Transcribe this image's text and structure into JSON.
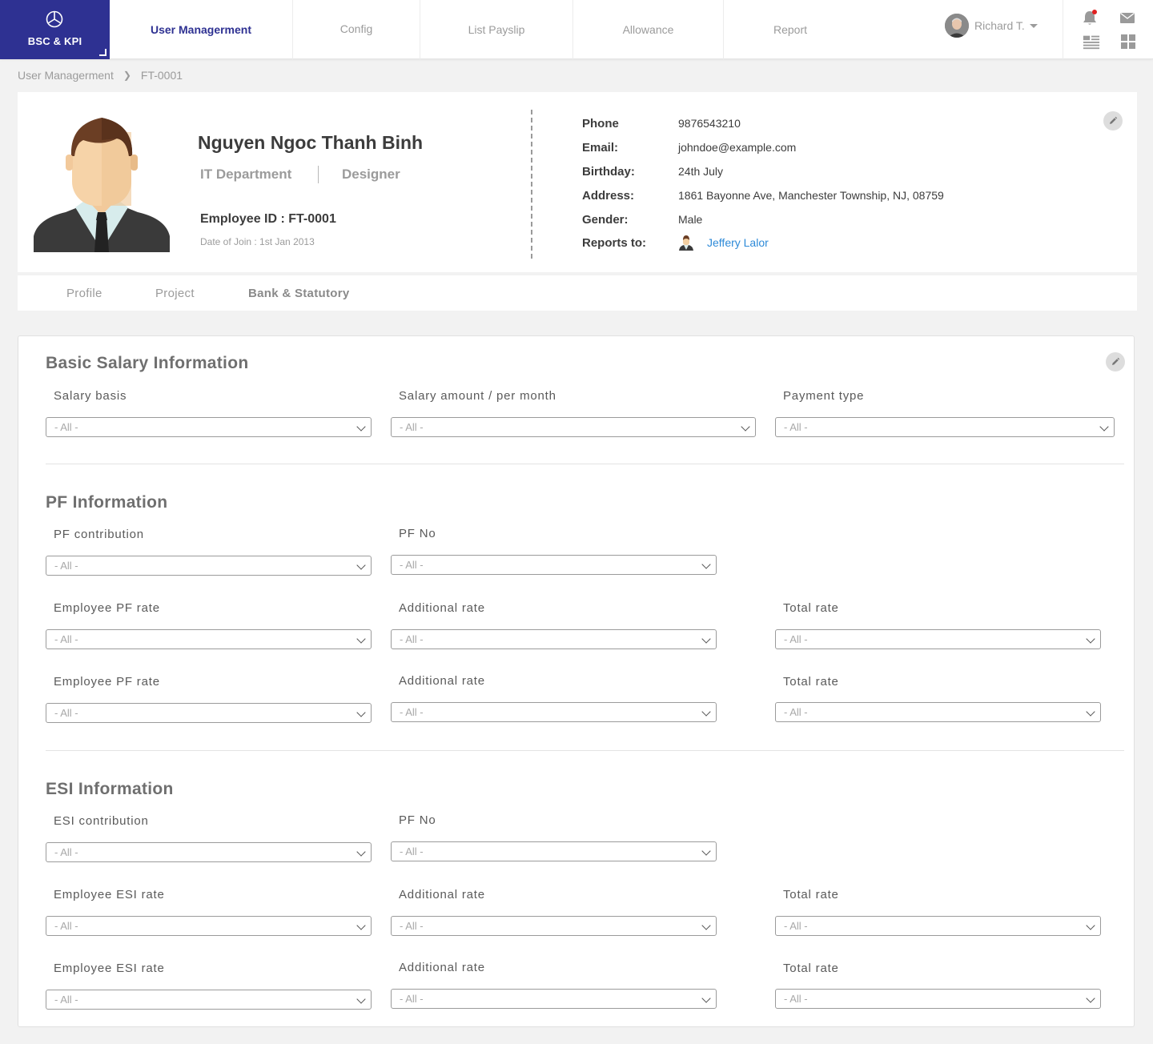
{
  "app": {
    "brand": "BSC & KPI"
  },
  "nav": {
    "items": [
      "User Managerment",
      "Config",
      "List Payslip",
      "Allowance",
      "Report"
    ],
    "active": 0
  },
  "user": {
    "name": "Richard T."
  },
  "breadcrumb": [
    "User Managerment",
    "FT-0001"
  ],
  "profile": {
    "name": "Nguyen Ngoc Thanh Binh",
    "department": "IT Department",
    "role": "Designer",
    "employee_id": "Employee ID : FT-0001",
    "date_of_join": "Date of Join : 1st Jan 2013",
    "info": [
      {
        "label": "Phone",
        "value": "9876543210"
      },
      {
        "label": "Email:",
        "value": "johndoe@example.com"
      },
      {
        "label": "Birthday:",
        "value": "24th July"
      },
      {
        "label": "Address:",
        "value": "1861 Bayonne Ave, Manchester Township, NJ, 08759"
      },
      {
        "label": "Gender:",
        "value": "Male"
      },
      {
        "label": "Reports to:",
        "value": "Jeffery Lalor"
      }
    ]
  },
  "tabs": [
    "Profile",
    "Project",
    "Bank & Statutory"
  ],
  "active_tab": 2,
  "select_placeholder": "- All -",
  "sections": {
    "basic": {
      "title": "Basic Salary Information",
      "labels": [
        "Salary basis",
        "Salary amount / per month",
        "Payment type"
      ]
    },
    "pf": {
      "title": "PF Information",
      "labels": [
        "PF contribution",
        "PF No",
        "Employee PF rate",
        "Additional rate",
        "Total rate",
        "Employee PF rate",
        "Additional rate",
        "Total rate"
      ]
    },
    "esi": {
      "title": "ESI Information",
      "labels": [
        "ESI contribution",
        "PF No",
        "Employee ESI rate",
        "Additional rate",
        "Total rate",
        "Employee ESI rate",
        "Additional rate",
        "Total rate"
      ]
    }
  },
  "colors": {
    "brand": "#2e3192",
    "link": "#2d8ad8",
    "notification": "#e02020"
  }
}
